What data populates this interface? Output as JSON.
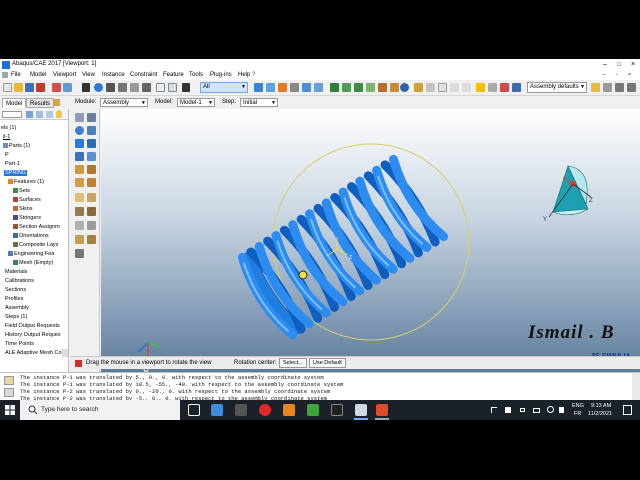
{
  "window": {
    "title": "Abaqus/CAE 2017 [Viewport: 1]",
    "minimize": "–",
    "maximize": "□",
    "close": "×"
  },
  "menubar": {
    "items": [
      "File",
      "Model",
      "Viewport",
      "View",
      "Instance",
      "Constraint",
      "Feature",
      "Tools",
      "Plug-ins",
      "Help"
    ],
    "help_extra": "?"
  },
  "toolbar": {
    "selection_filter": "All",
    "render_style": "Assembly defaults"
  },
  "context": {
    "tabs": [
      "Model",
      "Results"
    ],
    "module_label": "Module:",
    "module_value": "Assembly",
    "model_label": "Model:",
    "model_value": "Model-1",
    "step_label": "Step:",
    "step_value": "Initial"
  },
  "tree": {
    "items": [
      "els (1)",
      "il-1",
      "Parts (1)",
      "P",
      "Part-1",
      "SPRING",
      "Features (1)",
      "Sets",
      "Surfaces",
      "Skins",
      "Stringers",
      "Section Assignm",
      "Orientations",
      "Composite Lays",
      "Engineering Fea",
      "Mesh (Empty)",
      "Materials",
      "Calibrations",
      "Sections",
      "Profiles",
      "Assembly",
      "Steps (1)",
      "Field Output Requests",
      "History Output Reques",
      "Time Points",
      "ALE Adaptive Mesh Co"
    ]
  },
  "viewport": {
    "triad": {
      "x": "X",
      "y": "Y",
      "z": "Z"
    },
    "mini_triad": {
      "y": "Y",
      "z": "Z"
    },
    "watermark": "Ismail . B",
    "brand": "3S SIMULIA"
  },
  "prompt": {
    "text": "Drag the mouse in a viewport to rotate the view",
    "rotation_label": "Rotation center:",
    "select_button": "Select...",
    "default_button": "Use Default"
  },
  "messages": [
    "The instance P-1 was translated by 5., 0., 0. with respect to the assembly coordinate system",
    "The instance P-1 was translated by 18.5, -55., -40. with respect to the assembly coordinate system",
    "The instance P-2 was translated by 0., -20., 0. with respect to the assembly coordinate system",
    "The instance P-2 was translated by -5., 0., 0. with respect to the assembly coordinate system"
  ],
  "taskbar": {
    "search_placeholder": "Type here to search",
    "language": "ENG",
    "region": "FR",
    "time": "9:13 AM",
    "date": "11/2/2021"
  },
  "colors": {
    "spring": "#1f7fe0",
    "spring_dark": "#0c4fa8",
    "rotation_circle": "#d8cf6a"
  }
}
